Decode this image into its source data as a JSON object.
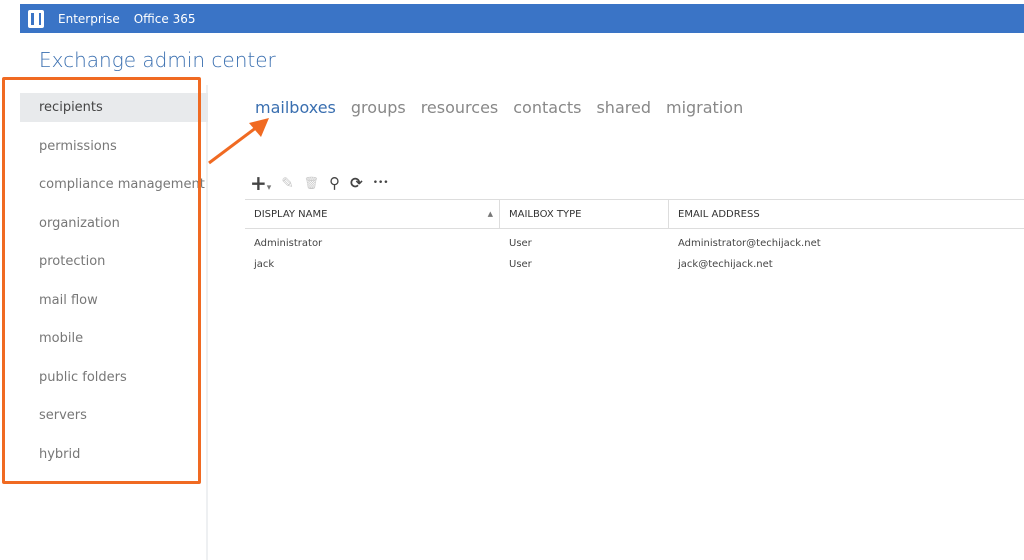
{
  "topbar": {
    "items": [
      "Enterprise",
      "Office 365"
    ]
  },
  "title": "Exchange admin center",
  "sidebar": {
    "items": [
      "recipients",
      "permissions",
      "compliance management",
      "organization",
      "protection",
      "mail flow",
      "mobile",
      "public folders",
      "servers",
      "hybrid"
    ],
    "selected": "recipients"
  },
  "tabs": {
    "items": [
      "mailboxes",
      "groups",
      "resources",
      "contacts",
      "shared",
      "migration"
    ],
    "selected": "mailboxes"
  },
  "toolbar": {
    "add": "+",
    "add_menu": "▾",
    "edit": "✎",
    "delete": "🗑",
    "search": "⚲",
    "refresh": "⟳",
    "more": "•••"
  },
  "table": {
    "columns": [
      "DISPLAY NAME",
      "MAILBOX TYPE",
      "EMAIL ADDRESS"
    ],
    "sort_indicator": "▲",
    "rows": [
      [
        "Administrator",
        "User",
        "Administrator@techijack.net"
      ],
      [
        "jack",
        "User",
        "jack@techijack.net"
      ]
    ]
  },
  "colors": {
    "brand": "#3a74c6",
    "highlight": "#f06a22"
  }
}
